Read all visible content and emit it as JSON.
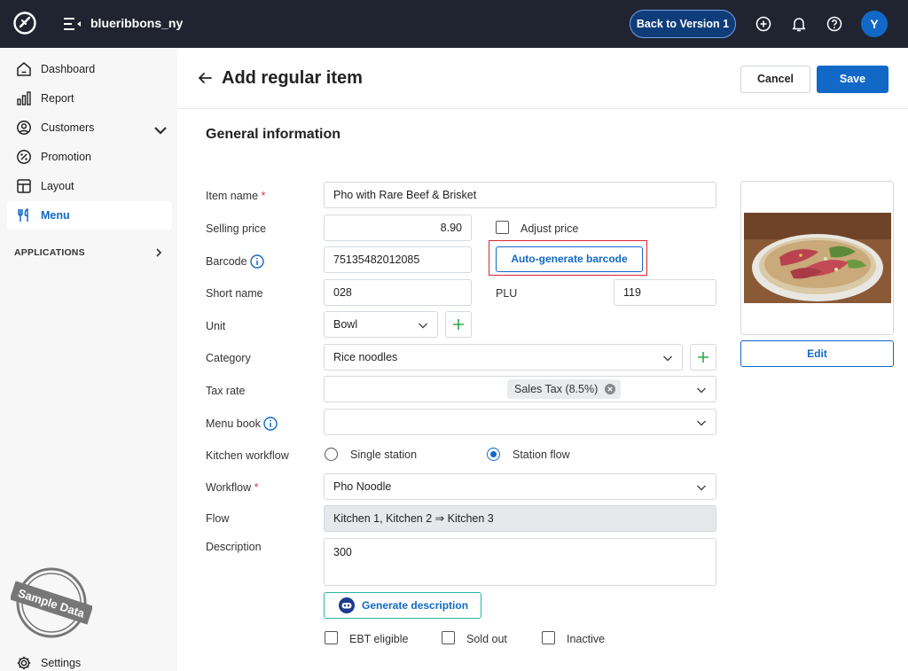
{
  "topbar": {
    "store_name": "blueribbons_ny",
    "back_label": "Back to Version 1",
    "avatar_initial": "Y",
    "icons": [
      "app-logo-icon",
      "menu-toggle-icon",
      "add-circle-icon",
      "bell-icon",
      "help-icon"
    ]
  },
  "sidebar": {
    "items": [
      {
        "label": "Dashboard",
        "icon": "home-icon"
      },
      {
        "label": "Report",
        "icon": "bar-chart-icon"
      },
      {
        "label": "Customers",
        "icon": "user-circle-icon"
      },
      {
        "label": "Promotion",
        "icon": "percent-icon"
      },
      {
        "label": "Layout",
        "icon": "layout-icon"
      },
      {
        "label": "Menu",
        "icon": "fork-knife-icon",
        "active": true
      }
    ],
    "applications_label": "APPLICATIONS",
    "stamp_text": "Sample Data",
    "settings_label": "Settings"
  },
  "header": {
    "title": "Add regular item",
    "cancel_label": "Cancel",
    "save_label": "Save"
  },
  "form": {
    "section_title": "General information",
    "item_name": {
      "label": "Item name",
      "required_mark": "*",
      "value": "Pho with Rare Beef & Brisket"
    },
    "selling_price": {
      "label": "Selling price",
      "value": "8.90",
      "adjust_label": "Adjust price",
      "adjust_checked": false
    },
    "barcode": {
      "label": "Barcode",
      "value": "75135482012085",
      "autogen_label": "Auto-generate barcode"
    },
    "short_name": {
      "label": "Short name",
      "value": "028",
      "plu_label": "PLU",
      "plu_value": "119"
    },
    "unit": {
      "label": "Unit",
      "value": "Bowl"
    },
    "category": {
      "label": "Category",
      "value": "Rice noodles"
    },
    "tax_rate": {
      "label": "Tax rate",
      "chip": "Sales Tax (8.5%)"
    },
    "menu_book": {
      "label": "Menu book",
      "value": ""
    },
    "kitchen_workflow": {
      "label": "Kitchen workflow",
      "option_single": "Single station",
      "option_flow": "Station flow",
      "selected": "Station flow"
    },
    "workflow": {
      "label": "Workflow",
      "required_mark": "*",
      "value": "Pho Noodle"
    },
    "flow": {
      "label": "Flow",
      "value": "Kitchen 1, Kitchen 2 ⇒ Kitchen 3"
    },
    "description": {
      "label": "Description",
      "value": "300"
    },
    "generate_label": "Generate description",
    "ebt_label": "EBT eligible",
    "sold_out_label": "Sold out",
    "inactive_label": "Inactive"
  },
  "image_panel": {
    "edit_label": "Edit"
  },
  "colors": {
    "accent": "#1168c6",
    "topbar": "#202430",
    "required": "#d9363e",
    "highlight": "#d9252f",
    "add_green": "#2aa84a"
  }
}
